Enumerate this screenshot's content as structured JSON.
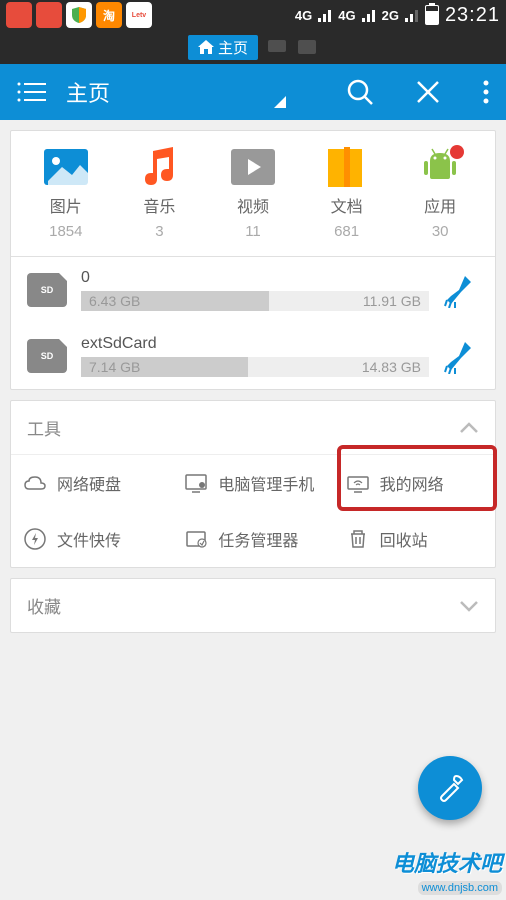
{
  "status": {
    "net1": "4G",
    "net2": "4G",
    "net3": "2G",
    "time": "23:21"
  },
  "tabs": {
    "home": "主页"
  },
  "appbar": {
    "title": "主页"
  },
  "categories": [
    {
      "label": "图片",
      "count": "1854"
    },
    {
      "label": "音乐",
      "count": "3"
    },
    {
      "label": "视频",
      "count": "11"
    },
    {
      "label": "文档",
      "count": "681"
    },
    {
      "label": "应用",
      "count": "30"
    }
  ],
  "storage": [
    {
      "name": "0",
      "used": "6.43 GB",
      "total": "11.91 GB",
      "fill_pct": 54
    },
    {
      "name": "extSdCard",
      "used": "7.14 GB",
      "total": "14.83 GB",
      "fill_pct": 48
    }
  ],
  "sections": {
    "tools": "工具",
    "favorites": "收藏"
  },
  "tools": [
    {
      "label": "网络硬盘"
    },
    {
      "label": "电脑管理手机"
    },
    {
      "label": "我的网络"
    },
    {
      "label": "文件快传"
    },
    {
      "label": "任务管理器"
    },
    {
      "label": "回收站"
    }
  ],
  "sd_text": "SD",
  "taobao_text": "淘",
  "watermark": {
    "text": "电脑技术吧",
    "url": "www.dnjsb.com"
  }
}
